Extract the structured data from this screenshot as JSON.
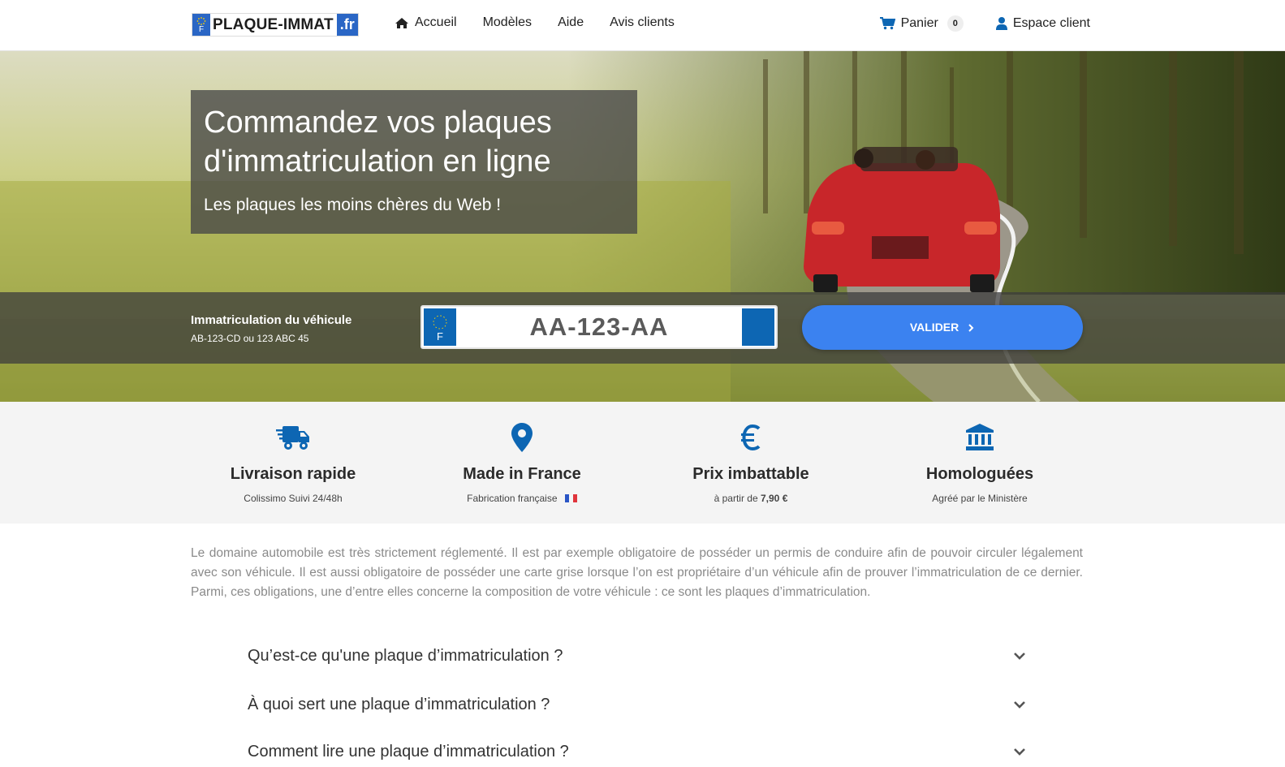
{
  "brand": {
    "logo_text": "PLAQUE-IMMAT",
    "logo_tld": ".fr",
    "eu_letter": "F"
  },
  "nav": {
    "links": [
      {
        "label": "Accueil",
        "icon": "home-icon"
      },
      {
        "label": "Modèles"
      },
      {
        "label": "Aide"
      },
      {
        "label": "Avis clients"
      }
    ],
    "cart": {
      "label": "Panier",
      "count": "0",
      "icon": "cart-icon"
    },
    "account": {
      "label": "Espace client",
      "icon": "user-icon"
    }
  },
  "hero": {
    "title": "Commandez vos plaques d'immatriculation en ligne",
    "subtitle": "Les plaques les moins chères du Web !"
  },
  "plate_form": {
    "label": "Immatriculation du véhicule",
    "hint": "AB-123-CD ou 123 ABC 45",
    "placeholder": "AA-123-AA",
    "eu_letter": "F",
    "submit_label": "VALIDER",
    "submit_icon": "chevron-right-icon"
  },
  "features": [
    {
      "title": "Livraison rapide",
      "subtitle": "Colissimo Suivi 24/48h",
      "icon": "shipping-truck-icon"
    },
    {
      "title": "Made in France",
      "subtitle": "Fabrication française",
      "icon": "map-pin-icon"
    },
    {
      "title": "Prix imbattable",
      "subtitle_prefix": "à partir de",
      "subtitle_price": "7,90 €",
      "icon": "euro-icon"
    },
    {
      "title": "Homologuées",
      "subtitle": "Agréé par le Ministère",
      "icon": "institution-icon"
    }
  ],
  "intro": "Le domaine automobile est très strictement réglementé. Il est par exemple obligatoire de posséder un permis de conduire afin de pouvoir circuler légalement avec son véhicule. Il est aussi obligatoire de posséder une carte grise lorsque l’on est propriétaire d’un véhicule afin de prouver l’immatriculation de ce dernier. Parmi, ces obligations, une d’entre elles concerne la composition de votre véhicule : ce sont les plaques d’immatriculation.",
  "faq": [
    {
      "question": "Qu’est-ce qu'une plaque d’immatriculation ?"
    },
    {
      "question": "À quoi sert une plaque d’immatriculation ?"
    },
    {
      "question": "Comment lire une plaque d’immatriculation ?"
    }
  ],
  "colors": {
    "accent": "#3b82f0",
    "icon_blue": "#0d66b3",
    "eu_blue": "#2a66c5"
  }
}
